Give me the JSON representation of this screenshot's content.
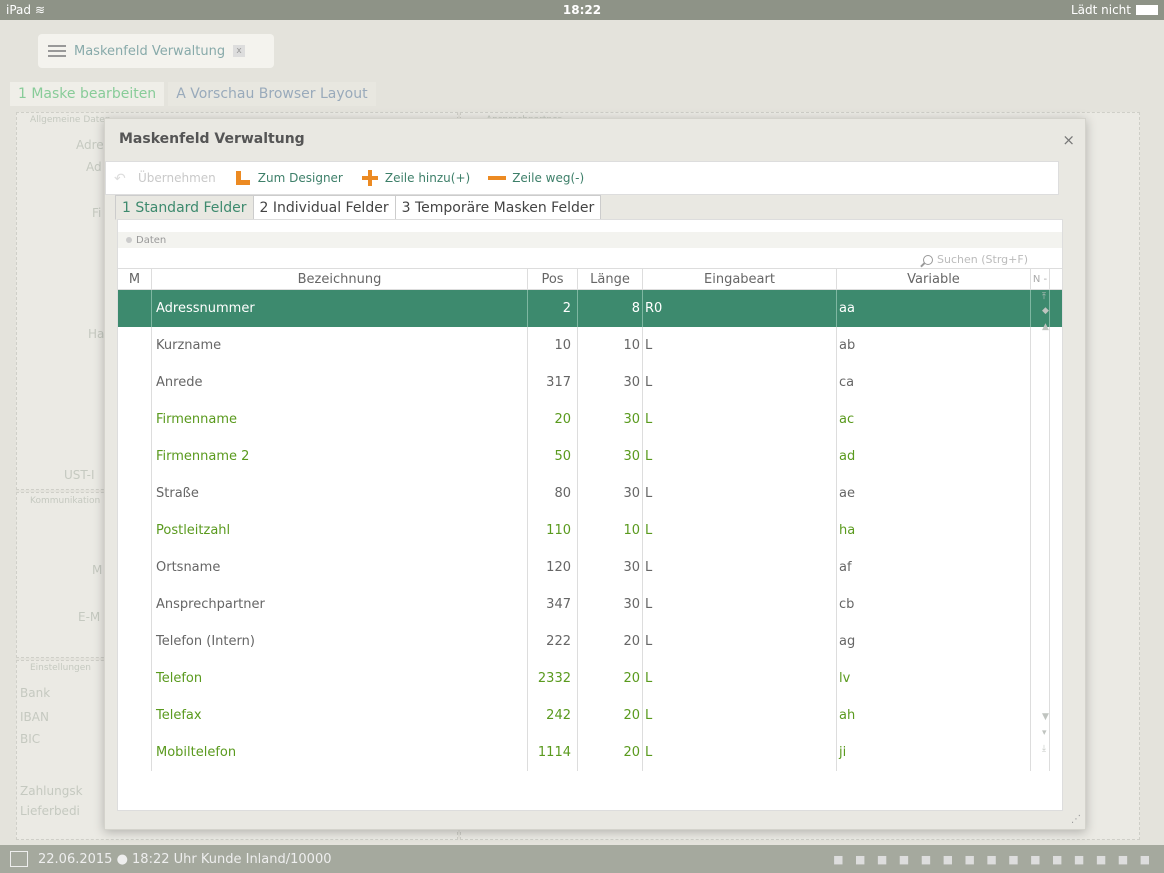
{
  "status": {
    "device": "iPad",
    "wifi_icon": "wifi-icon",
    "time": "18:22",
    "charging": "Lädt nicht"
  },
  "background": {
    "tab_title": "Maskenfeld Verwaltung",
    "subtabs": [
      "1 Maske bearbeiten",
      "A Vorschau Browser Layout"
    ],
    "panel_labels": [
      "Allgemeine Daten",
      "Ansprechpartner",
      "Kommunikation",
      "Einstellungen"
    ],
    "field_labels": [
      "Adre",
      "Ad",
      "Fi",
      "Ha",
      "UST-I",
      "M",
      "E-M",
      "Bank",
      "IBAN",
      "BIC",
      "Zahlungsk",
      "Lieferbedi"
    ],
    "footer": "22.06.2015 ● 18:22 Uhr   Kunde Inland/10000"
  },
  "dialog": {
    "title": "Maskenfeld Verwaltung",
    "close": "×",
    "toolbar": {
      "apply": "Übernehmen",
      "designer": "Zum Designer",
      "add_row": "Zeile hinzu(+)",
      "remove_row": "Zeile weg(-)"
    },
    "tabs": [
      "1 Standard Felder",
      "2 Individual Felder",
      "3 Temporäre Masken Felder"
    ],
    "section": "Daten",
    "search": "Suchen (Strg+F)",
    "columns": {
      "m": "M",
      "bez": "Bezeichnung",
      "pos": "Pos",
      "len": "Länge",
      "ein": "Eingabeart",
      "var": "Variable",
      "n": "N -"
    },
    "rows": [
      {
        "bez": "Adressnummer",
        "pos": "2",
        "len": "8",
        "ein": "R0",
        "var": "aa",
        "style": "sel"
      },
      {
        "bez": "Kurzname",
        "pos": "10",
        "len": "10",
        "ein": "L",
        "var": "ab",
        "style": ""
      },
      {
        "bez": "Anrede",
        "pos": "317",
        "len": "30",
        "ein": "L",
        "var": "ca",
        "style": ""
      },
      {
        "bez": "Firmenname",
        "pos": "20",
        "len": "30",
        "ein": "L",
        "var": "ac",
        "style": "green"
      },
      {
        "bez": "Firmenname 2",
        "pos": "50",
        "len": "30",
        "ein": "L",
        "var": "ad",
        "style": "green"
      },
      {
        "bez": "Straße",
        "pos": "80",
        "len": "30",
        "ein": "L",
        "var": "ae",
        "style": ""
      },
      {
        "bez": "Postleitzahl",
        "pos": "110",
        "len": "10",
        "ein": "L",
        "var": "ha",
        "style": "green"
      },
      {
        "bez": "Ortsname",
        "pos": "120",
        "len": "30",
        "ein": "L",
        "var": "af",
        "style": ""
      },
      {
        "bez": "Ansprechpartner",
        "pos": "347",
        "len": "30",
        "ein": "L",
        "var": "cb",
        "style": ""
      },
      {
        "bez": "Telefon (Intern)",
        "pos": "222",
        "len": "20",
        "ein": "L",
        "var": "ag",
        "style": ""
      },
      {
        "bez": "Telefon",
        "pos": "2332",
        "len": "20",
        "ein": "L",
        "var": "lv",
        "style": "green"
      },
      {
        "bez": "Telefax",
        "pos": "242",
        "len": "20",
        "ein": "L",
        "var": "ah",
        "style": "green"
      },
      {
        "bez": "Mobiltelefon",
        "pos": "1114",
        "len": "20",
        "ein": "L",
        "var": "ji",
        "style": "green"
      }
    ]
  },
  "colors": {
    "accent": "#3d8a6e",
    "highlight_text": "#5a9a1e",
    "icon_orange": "#ec8a22"
  }
}
